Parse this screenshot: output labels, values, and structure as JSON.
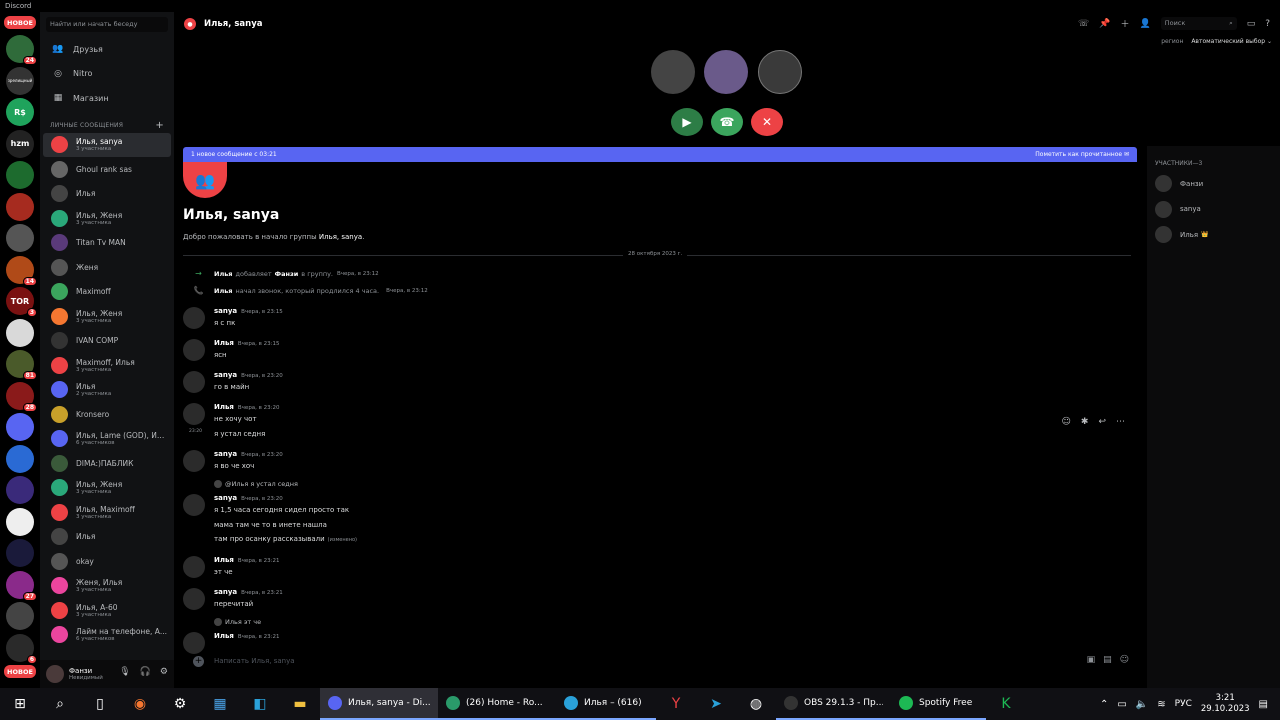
{
  "app": {
    "title": "Discord"
  },
  "servers": [
    {
      "label": "НОВОЕ",
      "kind": "pill"
    },
    {
      "label": "",
      "color": "#2f6b3a",
      "badge": "24"
    },
    {
      "label": "",
      "color": "#333",
      "sub": "зрелищный"
    },
    {
      "label": "R$",
      "color": "#1fa35c"
    },
    {
      "label": "hzm",
      "color": "#222"
    },
    {
      "label": "",
      "color": "#1d6b2e"
    },
    {
      "label": "",
      "color": "#a62b1f"
    },
    {
      "label": "",
      "color": "#555"
    },
    {
      "label": "",
      "color": "#b04a18",
      "badge": "14"
    },
    {
      "label": "TOR",
      "color": "#7a1111",
      "badge": "3"
    },
    {
      "label": "",
      "color": "#d9d9d9"
    },
    {
      "label": "",
      "color": "#4a5a2a",
      "badge": "81"
    },
    {
      "label": "",
      "color": "#8a1a1a",
      "badge": "28"
    },
    {
      "label": "",
      "color": "#5865f2"
    },
    {
      "label": "",
      "color": "#2a6ad4"
    },
    {
      "label": "",
      "color": "#3a2a7a"
    },
    {
      "label": "",
      "color": "#eee"
    },
    {
      "label": "",
      "color": "#1a1a3a"
    },
    {
      "label": "",
      "color": "#8a2a8a",
      "badge": "27"
    },
    {
      "label": "",
      "color": "#444"
    },
    {
      "label": "",
      "color": "#2a2a2a",
      "badge": "6"
    },
    {
      "label": "НОВОЕ",
      "kind": "pill"
    }
  ],
  "sidebar": {
    "search_placeholder": "Найти или начать беседу",
    "nav": [
      {
        "label": "Друзья",
        "icon": "👥"
      },
      {
        "label": "Nitro",
        "icon": "◎"
      },
      {
        "label": "Магазин",
        "icon": "▦"
      }
    ],
    "dm_header": "ЛИЧНЫЕ СООБЩЕНИЯ",
    "dms": [
      {
        "name": "Илья, sanya",
        "sub": "3 участника",
        "color": "#ed4245",
        "active": true
      },
      {
        "name": "Ghoul rank sas",
        "sub": "",
        "color": "#666"
      },
      {
        "name": "Илья",
        "sub": "",
        "color": "#444"
      },
      {
        "name": "Илья, Женя",
        "sub": "3 участника",
        "color": "#2aa87a"
      },
      {
        "name": "Titan Tv MAN",
        "sub": "",
        "color": "#5a3a7a"
      },
      {
        "name": "Женя",
        "sub": "",
        "color": "#555"
      },
      {
        "name": "Maximoff",
        "sub": "",
        "color": "#3ba55d"
      },
      {
        "name": "Илья, Женя",
        "sub": "3 участника",
        "color": "#f57731"
      },
      {
        "name": "IVAN COMP",
        "sub": "",
        "color": "#333"
      },
      {
        "name": "Maximoff, Илья",
        "sub": "3 участника",
        "color": "#ed4245"
      },
      {
        "name": "Илья",
        "sub": "2 участника",
        "color": "#5865f2"
      },
      {
        "name": "Kronsero",
        "sub": "",
        "color": "#c8a02a"
      },
      {
        "name": "Илья, Lame (GOD), Ил...",
        "sub": "6 участников",
        "color": "#5865f2"
      },
      {
        "name": "DIMA:)ПАБЛИК",
        "sub": "",
        "color": "#3a5a3a"
      },
      {
        "name": "Илья, Женя",
        "sub": "3 участника",
        "color": "#2aa87a"
      },
      {
        "name": "Илья, Maximoff",
        "sub": "3 участника",
        "color": "#ed4245"
      },
      {
        "name": "Илья",
        "sub": "",
        "color": "#444"
      },
      {
        "name": "okay",
        "sub": "",
        "color": "#555"
      },
      {
        "name": "Женя, Илья",
        "sub": "3 участника",
        "color": "#eb459e"
      },
      {
        "name": "Илья, А-60",
        "sub": "3 участника",
        "color": "#ed4245"
      },
      {
        "name": "Лайм на телефоне, А...",
        "sub": "6 участников",
        "color": "#eb459e"
      }
    ]
  },
  "user": {
    "name": "Фанзи",
    "status": "Невидимый"
  },
  "topbar": {
    "title": "Илья, sanya",
    "search_placeholder": "Поиск"
  },
  "region": {
    "label": "регион",
    "value": "Автоматический выбор"
  },
  "call": {
    "participants": [
      "#444",
      "#6a5a8a",
      "#3a3a3a"
    ]
  },
  "new_messages": {
    "text": "1 новое сообщение с 03:21",
    "action": "Пометить как прочитанное"
  },
  "channel": {
    "title": "Илья, sanya",
    "welcome_prefix": "Добро пожаловать в начало группы ",
    "welcome_name": "Илья, sanya",
    "welcome_suffix": ".",
    "date_divider": "28 октября 2023 г."
  },
  "system_messages": [
    {
      "arrow": "→",
      "color": "#3ba55d",
      "actor": "Илья",
      "action": "добавляет",
      "target": "Фанзи",
      "after": "в группу.",
      "time": "Вчера, в 23:12"
    },
    {
      "arrow": "📞",
      "color": "#3ba55d",
      "actor": "Илья",
      "action": "начал звонок, который продлился 4 часа.",
      "target": "",
      "after": "",
      "time": "Вчера, в 23:12"
    }
  ],
  "messages": [
    {
      "author": "sanya",
      "time": "Вчера, в 23:15",
      "lines": [
        "я с пк"
      ]
    },
    {
      "author": "Илья",
      "time": "Вчера, в 23:15",
      "lines": [
        "ясн"
      ]
    },
    {
      "author": "sanya",
      "time": "Вчера, в 23:20",
      "lines": [
        "го в майн"
      ]
    },
    {
      "author": "Илья",
      "time": "Вчера, в 23:20",
      "lines": [
        "не хочу чот",
        "я устал седня"
      ],
      "side_time": "23:20"
    },
    {
      "author": "sanya",
      "time": "Вчера, в 23:20",
      "lines": [
        "я во че хоч"
      ]
    },
    {
      "author": "sanya",
      "time": "Вчера, в 23:20",
      "reply": "@Илья я устал седня",
      "lines": [
        "я 1,5 часа сегодня сидел просто так",
        "мама там че то в инете нашла",
        "там про осанку рассказывали"
      ],
      "edited": "(изменено)"
    },
    {
      "author": "Илья",
      "time": "Вчера, в 23:21",
      "lines": [
        "эт че"
      ]
    },
    {
      "author": "sanya",
      "time": "Вчера, в 23:21",
      "lines": [
        "перечитай"
      ]
    },
    {
      "author": "Илья",
      "time": "Вчера, в 23:21",
      "reply": "Илья эт че",
      "lines": []
    }
  ],
  "composer": {
    "placeholder": "Написать Илья, sanya"
  },
  "members": {
    "header": "УЧАСТНИКИ—3",
    "list": [
      {
        "name": "Фанзи",
        "crown": ""
      },
      {
        "name": "sanya",
        "crown": ""
      },
      {
        "name": "Илья",
        "crown": "👑"
      }
    ]
  },
  "taskbar": {
    "apps": [
      {
        "label": "Илья, sanya - Di...",
        "color": "#5865f2",
        "active": true
      },
      {
        "label": "(26) Home - Ro...",
        "color": "#2a9a6a"
      },
      {
        "label": "Илья – (616)",
        "color": "#2aa1d9"
      },
      {
        "label": "OBS 29.1.3 - Пр...",
        "color": "#333"
      },
      {
        "label": "Spotify Free",
        "color": "#1db954"
      }
    ],
    "lang": "РУС",
    "time": "3:21",
    "date": "29.10.2023"
  }
}
